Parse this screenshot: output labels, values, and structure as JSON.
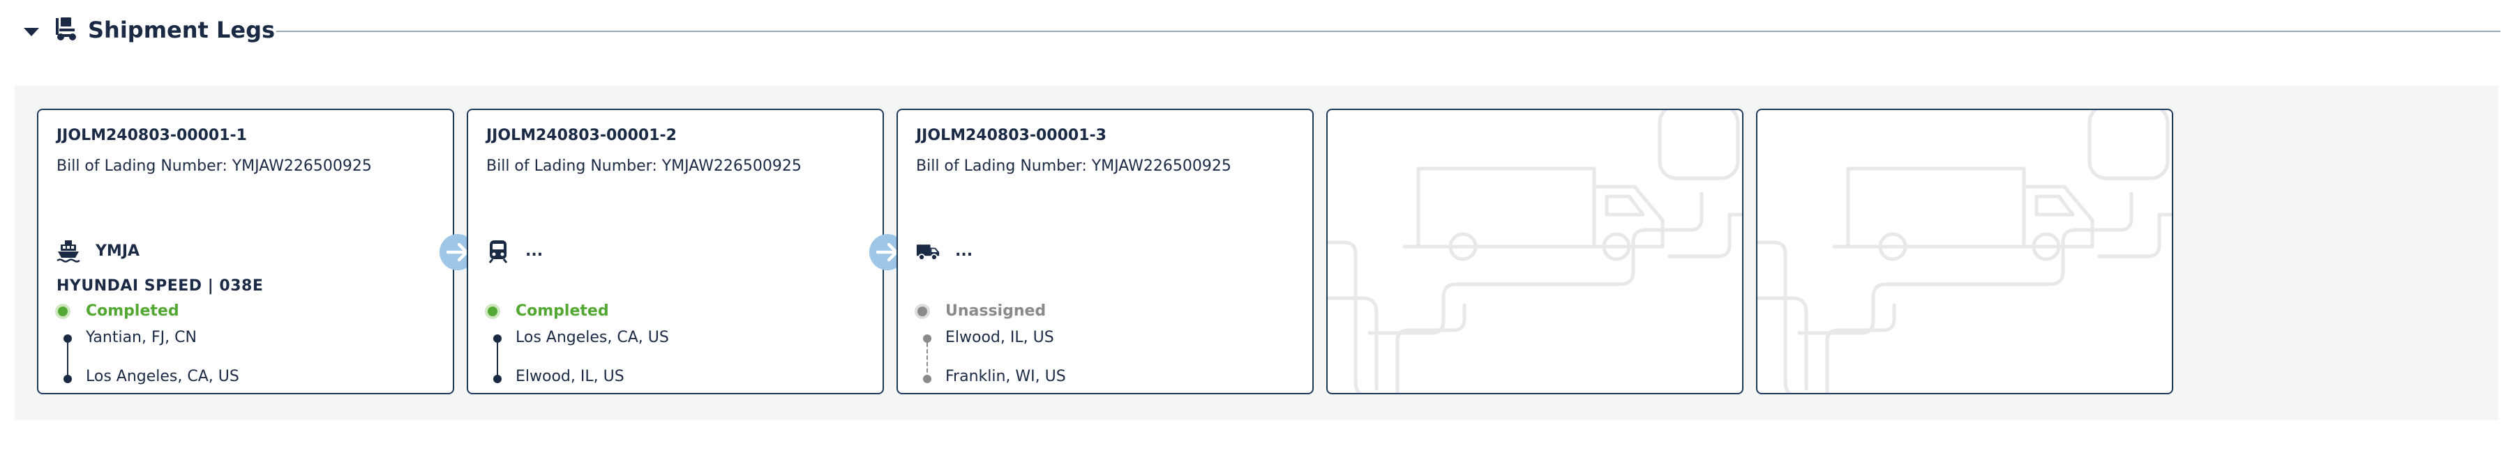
{
  "section": {
    "title": "Shipment Legs",
    "toggle_icon": "caret-down-icon",
    "header_icon": "dolly-icon"
  },
  "legs": [
    {
      "id": "JJOLM240803-00001-1",
      "bol": "Bill of Lading Number: YMJAW226500925",
      "mode_icon": "ship-icon",
      "carrier": "YMJA",
      "vessel": "HYUNDAI SPEED | 038E",
      "status": "Completed",
      "status_color": "#52a832",
      "origin": "Yantian, FJ, CN",
      "destination": "Los Angeles, CA, US"
    },
    {
      "id": "JJOLM240803-00001-2",
      "bol": "Bill of Lading Number: YMJAW226500925",
      "mode_icon": "train-icon",
      "carrier": "...",
      "status": "Completed",
      "status_color": "#52a832",
      "origin": "Los Angeles, CA, US",
      "destination": "Elwood, IL, US"
    },
    {
      "id": "JJOLM240803-00001-3",
      "bol": "Bill of Lading Number: YMJAW226500925",
      "mode_icon": "truck-icon",
      "carrier": "...",
      "status": "Unassigned",
      "status_color": "#8a8a8a",
      "origin": "Elwood, IL, US",
      "destination": "Franklin, WI, US"
    }
  ],
  "colors": {
    "navy": "#1b2a44",
    "card_border": "#1b3a5c",
    "panel_bg": "#f4f6f5",
    "connector": "#9cc5e6",
    "completed": "#52a832",
    "unassigned": "#8a8a8a",
    "placeholder_art": "#e6e8ea"
  },
  "empty_slots": [
    {
      "art_icon": "truck-route-illustration-icon"
    },
    {
      "art_icon": "truck-route-illustration-icon"
    }
  ]
}
